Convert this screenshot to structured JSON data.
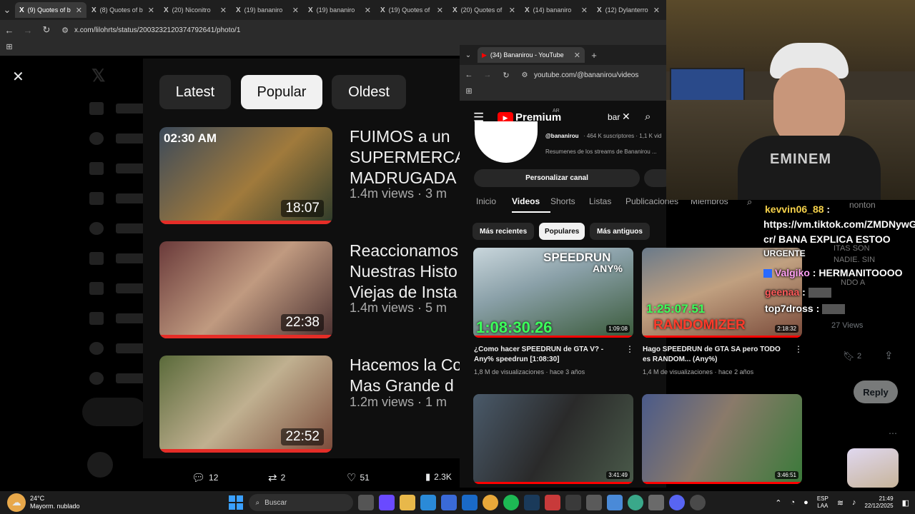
{
  "browser": {
    "tabs": [
      {
        "label": "(9) Quotes of b",
        "active": true
      },
      {
        "label": "(8) Quotes of b"
      },
      {
        "label": "(20) Niconitro"
      },
      {
        "label": "(19) bananiro"
      },
      {
        "label": "(19) bananiro"
      },
      {
        "label": "(19) Quotes of"
      },
      {
        "label": "(20) Quotes of"
      },
      {
        "label": "(14) bananiro"
      },
      {
        "label": "(12) Dylanterro"
      }
    ],
    "url": "x.com/lilohrts/status/2003232120374792641/photo/1"
  },
  "modal": {
    "filters": [
      "Latest",
      "Popular",
      "Oldest"
    ],
    "active_filter": "Popular",
    "videos": [
      {
        "title_lines": [
          "FUIMOS a un",
          "SUPERMERCA",
          "MADRUGADA"
        ],
        "meta": "1.4m views · 3 m",
        "duration": "18:07",
        "overlay": "02:30 AM"
      },
      {
        "title_lines": [
          "Reaccionamos",
          "Nuestras Histo",
          "Viejas de Insta"
        ],
        "meta": "1.4m views · 5 m",
        "duration": "22:38"
      },
      {
        "title_lines": [
          "Hacemos la Co",
          "Mas Grande d"
        ],
        "meta": "1.2m views · 1 m",
        "duration": "22:52"
      }
    ]
  },
  "post_actions": {
    "replies": "12",
    "reposts": "2",
    "likes": "51",
    "views": "2.3K"
  },
  "youtube": {
    "tab_title": "(34) Bananirou - YouTube",
    "url": "youtube.com/@bananirou/videos",
    "logo_text": "Premium",
    "logo_region": "AR",
    "search_value": "bar",
    "handle": "@bananirou",
    "subs": "· 464 K suscriptores · 1,1 K vid",
    "description": "Resumenes de los streams de Bananirou ...",
    "customize_button": "Personalizar canal",
    "nav": [
      "Inicio",
      "Videos",
      "Shorts",
      "Listas",
      "Publicaciones",
      "Miembros"
    ],
    "active_nav": "Videos",
    "sort_chips": [
      "Más recientes",
      "Populares",
      "Más antiguos"
    ],
    "active_sort": "Populares",
    "videos": [
      {
        "title": "¿Como hacer SPEEDRUN de GTA V? - Any% speedrun [1:08:30]",
        "meta": "1,8 M de visualizaciones · hace 3 años",
        "duration": "1:09:08",
        "thumb_top": "SPEEDRUN",
        "thumb_any": "ANY%",
        "thumb_time": "1:08:30.26"
      },
      {
        "title": "Hago SPEEDRUN de GTA SA pero TODO es RANDOM... (Any%)",
        "meta": "1,4 M de visualizaciones · hace 2 años",
        "duration": "2:18:32",
        "thumb_time": "1:25:07.51",
        "thumb_bottom": "RANDOMIZER"
      },
      {
        "title": "",
        "meta": "",
        "duration": "3:41:49"
      },
      {
        "title": "",
        "meta": "",
        "duration": "3:46:51"
      }
    ]
  },
  "chat": [
    {
      "user": "kevvin06_88",
      "user_color": "#f5d14a",
      "message": "https://vm.tiktok.com/ZMDNywG",
      "message2": "cr/ BANA EXPLICA ESTOO",
      "message3": "URGENTE"
    },
    {
      "user": "Valgiko",
      "user_color": "#ff9ff3",
      "message": "HERMANITOOOO"
    },
    {
      "user": "geenaa",
      "user_color": "#ff5a5a",
      "message": ""
    },
    {
      "user": "top7dross",
      "user_color": "#fff",
      "message": ""
    }
  ],
  "tweet_side": {
    "views_text": "27 Views",
    "bookmarks": "2",
    "reply_button": "Reply",
    "bg_text": "nonton",
    "bg_text2": "ITAS SON",
    "bg_text3": "NADIE. SIN",
    "bg_text4": "NDO A"
  },
  "taskbar": {
    "weather_temp": "24°C",
    "weather_desc": "Mayorm. nublado",
    "search_placeholder": "Buscar",
    "lang": "ESP",
    "lang2": "LAA",
    "time": "21:49",
    "date": "22/12/2025"
  }
}
